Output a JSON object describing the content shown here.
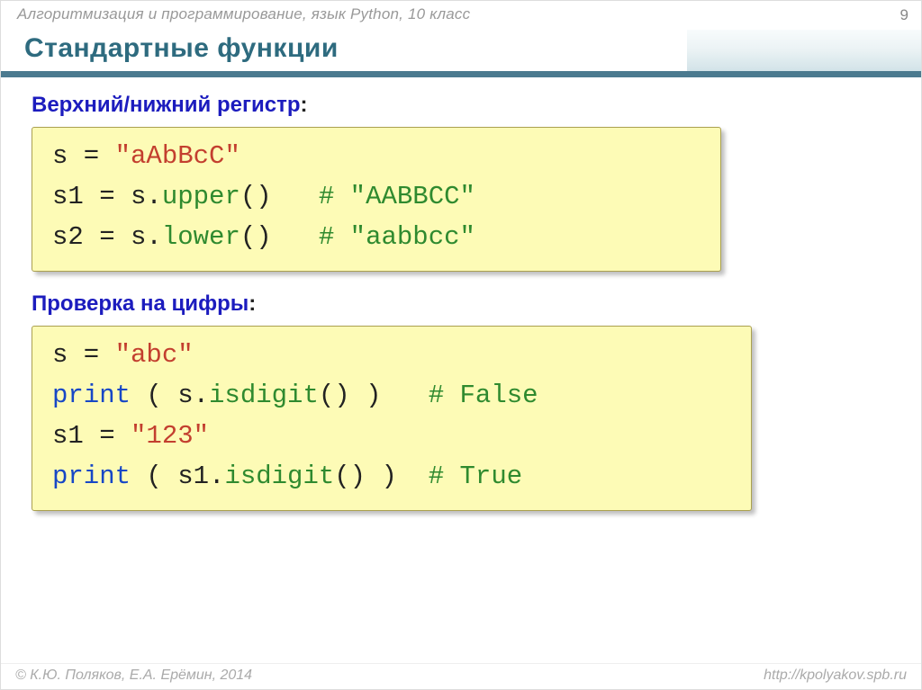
{
  "header": "Алгоритмизация и программирование, язык Python, 10 класс",
  "page_number": "9",
  "title": "Стандартные функции",
  "section1": {
    "heading": "Верхний/нижний регистр",
    "code": {
      "l1_var": "s",
      "l1_eq": " = ",
      "l1_str": "\"aAbBcC\"",
      "l2_var": "s1",
      "l2_eq": " = s.",
      "l2_fn": "upper",
      "l2_paren": "()",
      "l2_sp": "   ",
      "l2_cm": "# \"AABBCC\"",
      "l3_var": "s2",
      "l3_eq": " = s.",
      "l3_fn": "lower",
      "l3_paren": "()",
      "l3_sp": "   ",
      "l3_cm": "# \"aabbcc\""
    }
  },
  "section2": {
    "heading": "Проверка на цифры",
    "code": {
      "l1_var": "s",
      "l1_eq": " = ",
      "l1_str": "\"abc\"",
      "l2_kw": "print",
      "l2_a": " ( s.",
      "l2_fn": "isdigit",
      "l2_b": "() )",
      "l2_sp": "   ",
      "l2_cm": "# False",
      "l3_var": "s1",
      "l3_eq": " = ",
      "l3_str": "\"123\"",
      "l4_kw": "print",
      "l4_a": " ( s1.",
      "l4_fn": "isdigit",
      "l4_b": "() )",
      "l4_sp": "  ",
      "l4_cm": "# True"
    }
  },
  "footer": {
    "left": "© К.Ю. Поляков, Е.А. Ерёмин, 2014",
    "right": "http://kpolyakov.spb.ru"
  }
}
